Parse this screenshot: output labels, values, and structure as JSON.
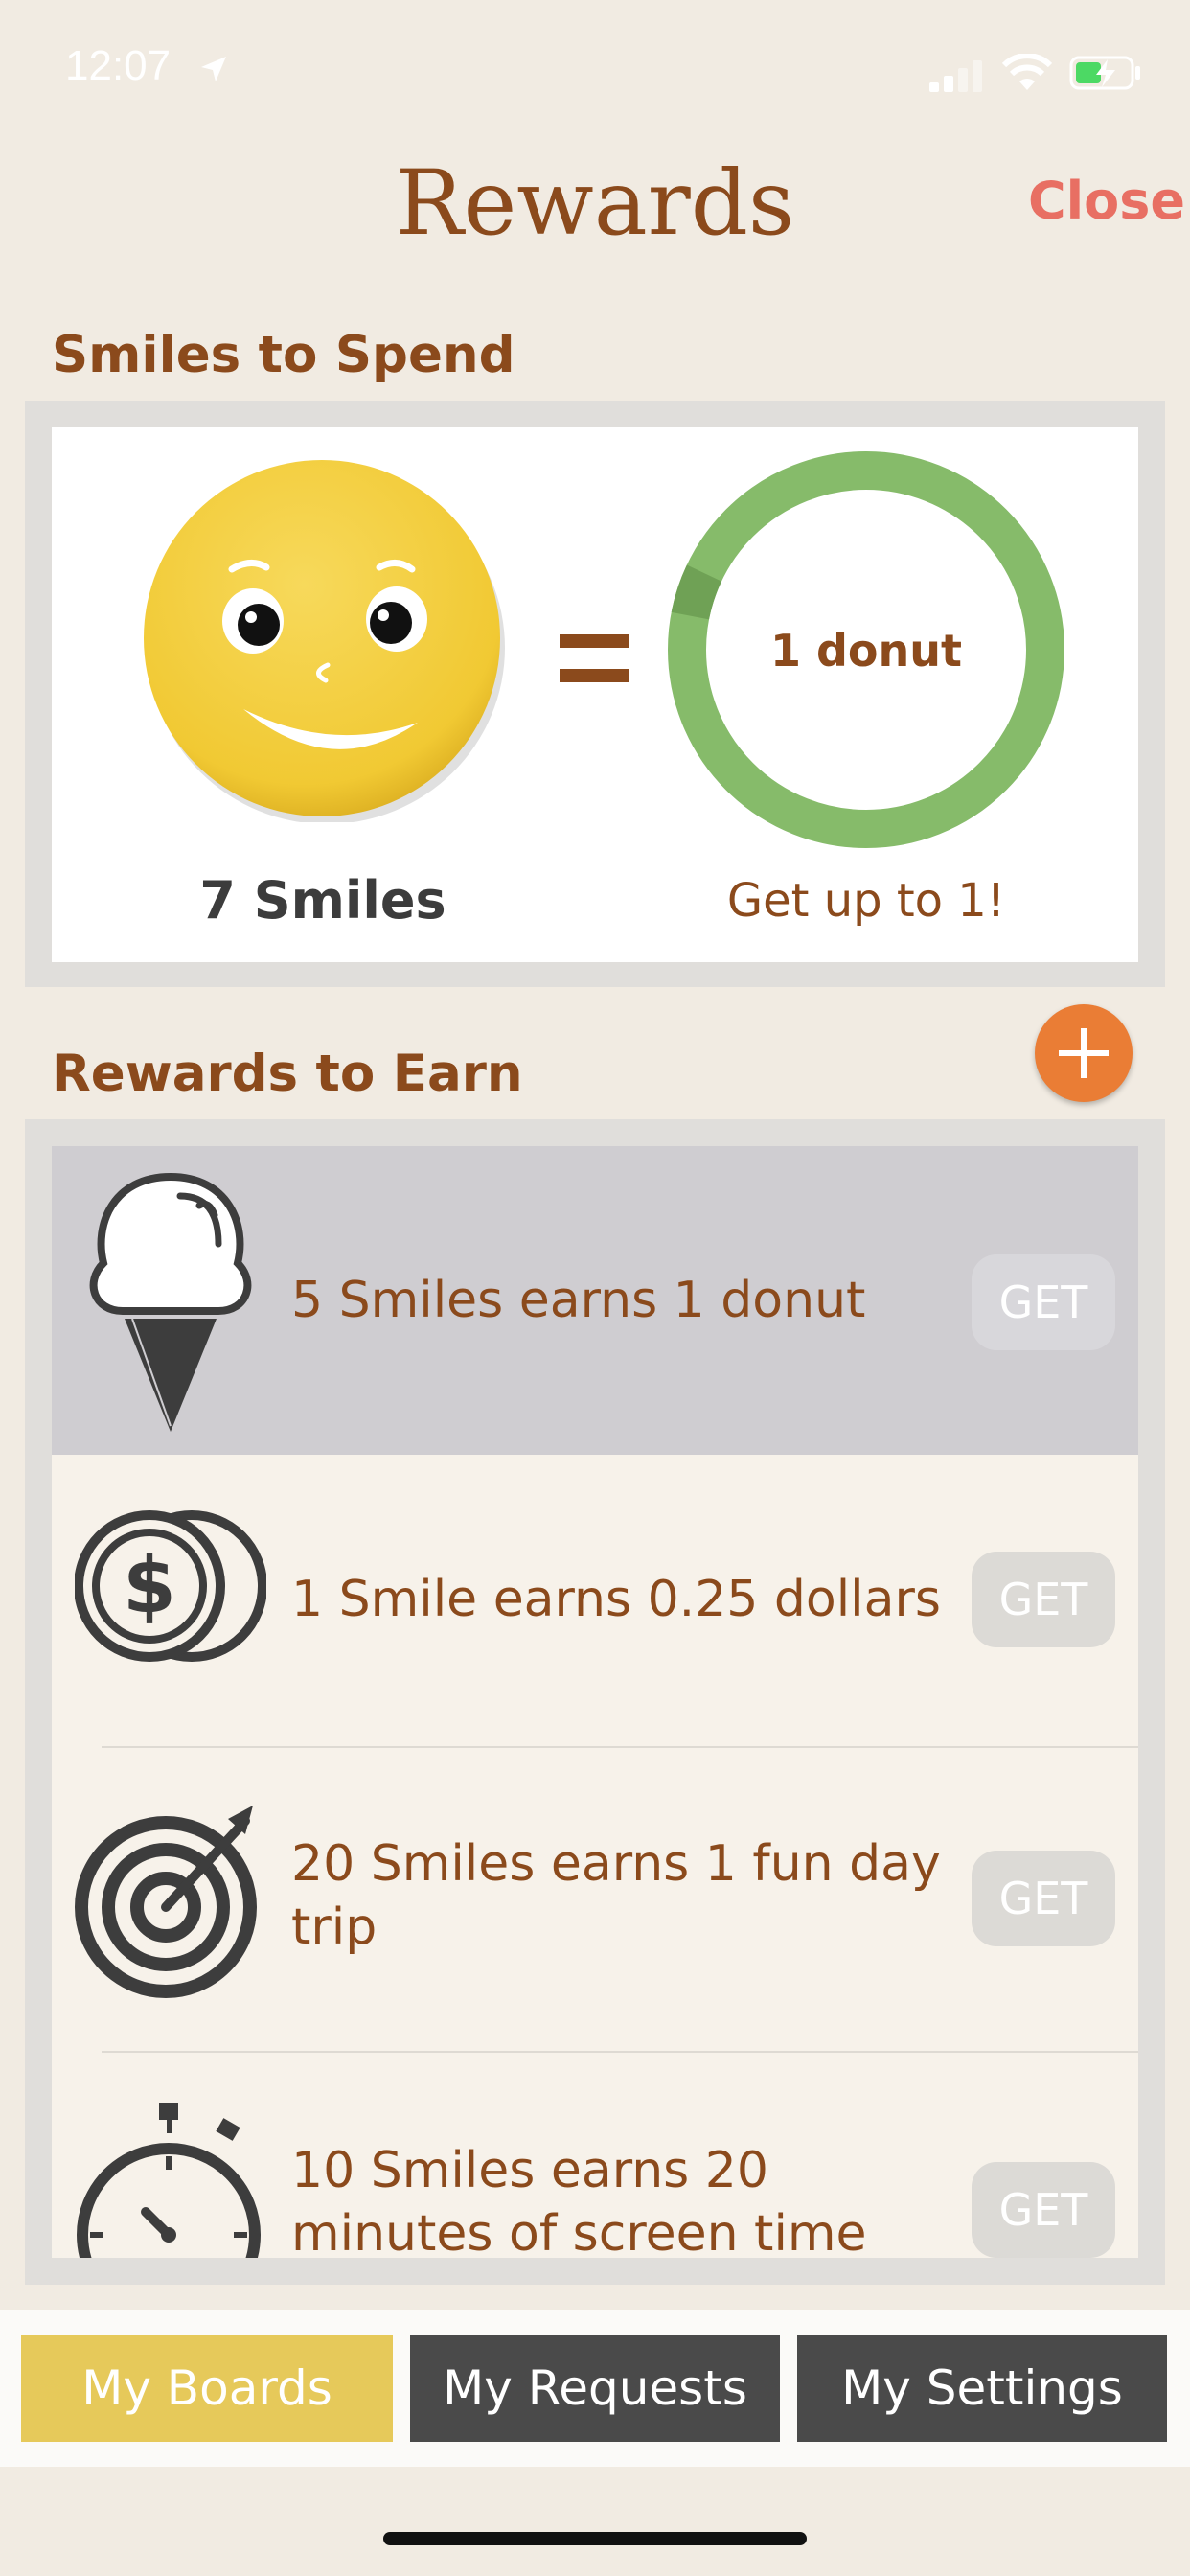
{
  "status_bar": {
    "time": "12:07"
  },
  "header": {
    "title": "Rewards",
    "close_label": "Close"
  },
  "spend": {
    "section_title": "Smiles to Spend",
    "smiles_label": "7 Smiles",
    "reward_label": "1 donut",
    "progress_fraction": 0.82,
    "subtext": "Get up to 1!"
  },
  "earn": {
    "section_title": "Rewards to Earn",
    "items": [
      {
        "icon": "ice-cream-icon",
        "text": "5 Smiles earns 1 donut",
        "button": "GET",
        "selected": true
      },
      {
        "icon": "coins-dollar-icon",
        "text": "1 Smile earns 0.25 dollars",
        "button": "GET"
      },
      {
        "icon": "target-icon",
        "text": "20 Smiles earns 1 fun day trip",
        "button": "GET"
      },
      {
        "icon": "stopwatch-icon",
        "text": "10 Smiles earns 20 minutes of screen time",
        "button": "GET"
      }
    ]
  },
  "tabs": [
    "My Boards",
    "My Requests",
    "My Settings"
  ],
  "colors": {
    "brown": "#8b4a1c",
    "ring_green": "#86bb6a",
    "accent_orange": "#ea7d35",
    "close_red": "#e86f63",
    "tab_active": "#e6c95a",
    "tab_inactive": "#4a4a4a"
  }
}
